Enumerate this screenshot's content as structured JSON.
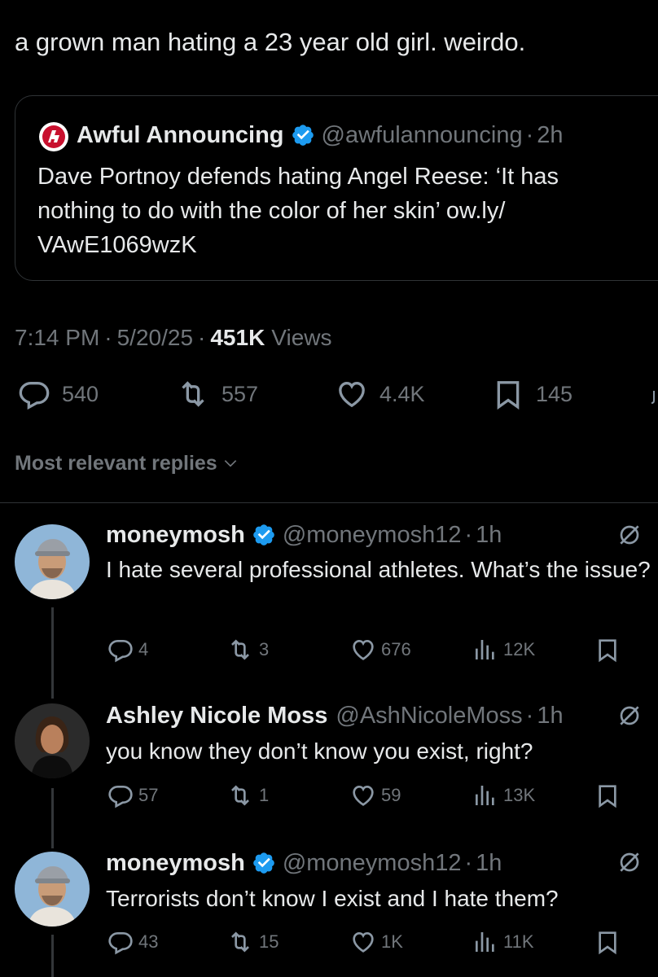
{
  "tweet": {
    "text": "a grown man hating a 23 year old girl. weirdo.",
    "quote": {
      "author_name": "Awful Announcing",
      "author_handle": "@awfulannouncing",
      "separator": "·",
      "time": "2h",
      "text": "Dave Portnoy defends hating Angel Reese: ‘It has nothing to do with the color of her skin’ ow.ly/ VAwE1069wzK"
    },
    "meta": {
      "time": "7:14 PM",
      "sep1": "·",
      "date": "5/20/25",
      "sep2": "·",
      "views_count": "451K",
      "views_label": "Views"
    },
    "actions": {
      "replies": "540",
      "reposts": "557",
      "likes": "4.4K",
      "bookmarks": "145"
    }
  },
  "replies_sort": {
    "label": "Most relevant replies"
  },
  "replies": [
    {
      "name": "moneymosh",
      "handle": "@moneymosh12",
      "separator": "·",
      "time": "1h",
      "text": "I hate several professional athletes. What’s the issue?",
      "replies": "4",
      "reposts": "3",
      "likes": "676",
      "views": "12K",
      "verified": true
    },
    {
      "name": "Ashley Nicole Moss",
      "handle": "@AshNicoleMoss",
      "separator": "·",
      "time": "1h",
      "text": "you know they don’t know you exist, right?",
      "replies": "57",
      "reposts": "1",
      "likes": "59",
      "views": "13K",
      "verified": false
    },
    {
      "name": "moneymosh",
      "handle": "@moneymosh12",
      "separator": "·",
      "time": "1h",
      "text": "Terrorists don’t know I exist and I hate them?",
      "replies": "43",
      "reposts": "15",
      "likes": "1K",
      "views": "11K",
      "verified": true
    }
  ],
  "colors": {
    "background": "#000000",
    "text": "#e7e9ea",
    "muted": "#71767b",
    "verified": "#1d9bf0",
    "border": "#2f3336",
    "quote_logo": "#c8102e"
  },
  "icons": [
    "reply-icon",
    "repost-icon",
    "like-icon",
    "bookmark-icon",
    "views-icon",
    "verified-icon",
    "grok-icon",
    "chevron-down-icon"
  ]
}
